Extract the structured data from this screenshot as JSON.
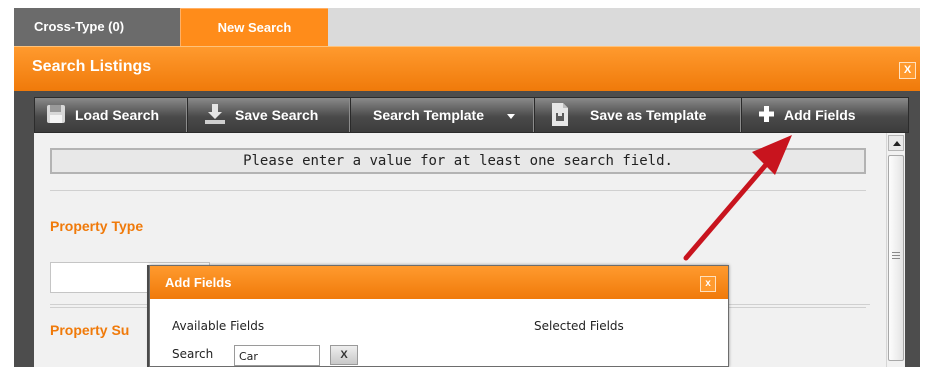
{
  "tabs": {
    "cross_type": "Cross-Type (0)",
    "new_search": "New Search"
  },
  "dialog": {
    "title": "Search Listings",
    "close": "X"
  },
  "toolbar": {
    "load_search": "Load Search",
    "save_search": "Save Search",
    "search_template": "Search Template",
    "save_as_template": "Save as Template",
    "add_fields": "Add Fields"
  },
  "content": {
    "message": "Please enter a value for at least one search field.",
    "property_type_label": "Property Type",
    "property_subtype_label": "Property Su"
  },
  "add_fields_popup": {
    "title": "Add Fields",
    "close": "x",
    "available_fields_label": "Available Fields",
    "selected_fields_label": "Selected Fields",
    "search_label": "Search",
    "search_value": "Car",
    "clear_label": "X"
  },
  "colors": {
    "accent": "#f07a0a",
    "annotation_arrow": "#c8141e"
  },
  "icons": {
    "load_search": "floppy-disk-icon",
    "save_search": "save-download-icon",
    "search_template": "dropdown-caret-icon",
    "save_as_template": "document-save-icon",
    "add_fields": "plus-icon"
  }
}
